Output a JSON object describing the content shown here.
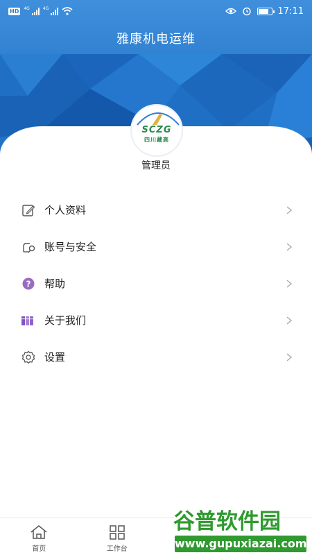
{
  "status_bar": {
    "hd_badge": "HD",
    "network_1": "4G",
    "network_2": "4G",
    "time": "17:11"
  },
  "header": {
    "title": "雅康机电运维"
  },
  "profile": {
    "logo_letters": "SCZG",
    "logo_subtitle": "四川藏高",
    "username": "管理员"
  },
  "menu": {
    "items": [
      {
        "label": "个人资料",
        "icon": "edit-icon"
      },
      {
        "label": "账号与安全",
        "icon": "account-security-icon"
      },
      {
        "label": "帮助",
        "icon": "help-icon"
      },
      {
        "label": "关于我们",
        "icon": "books-icon"
      },
      {
        "label": "设置",
        "icon": "gear-icon"
      }
    ]
  },
  "tabbar": {
    "tabs": [
      {
        "label": "首页",
        "icon": "home-icon"
      },
      {
        "label": "工作台",
        "icon": "grid-icon"
      }
    ]
  },
  "watermark": {
    "top_text": "谷普软件园",
    "bottom_text": "www.gupuxiazai.com"
  },
  "colors": {
    "header_blue": "#2f7fd0",
    "help_purple": "#9a6cc0",
    "watermark_green": "#2f9a2f"
  }
}
